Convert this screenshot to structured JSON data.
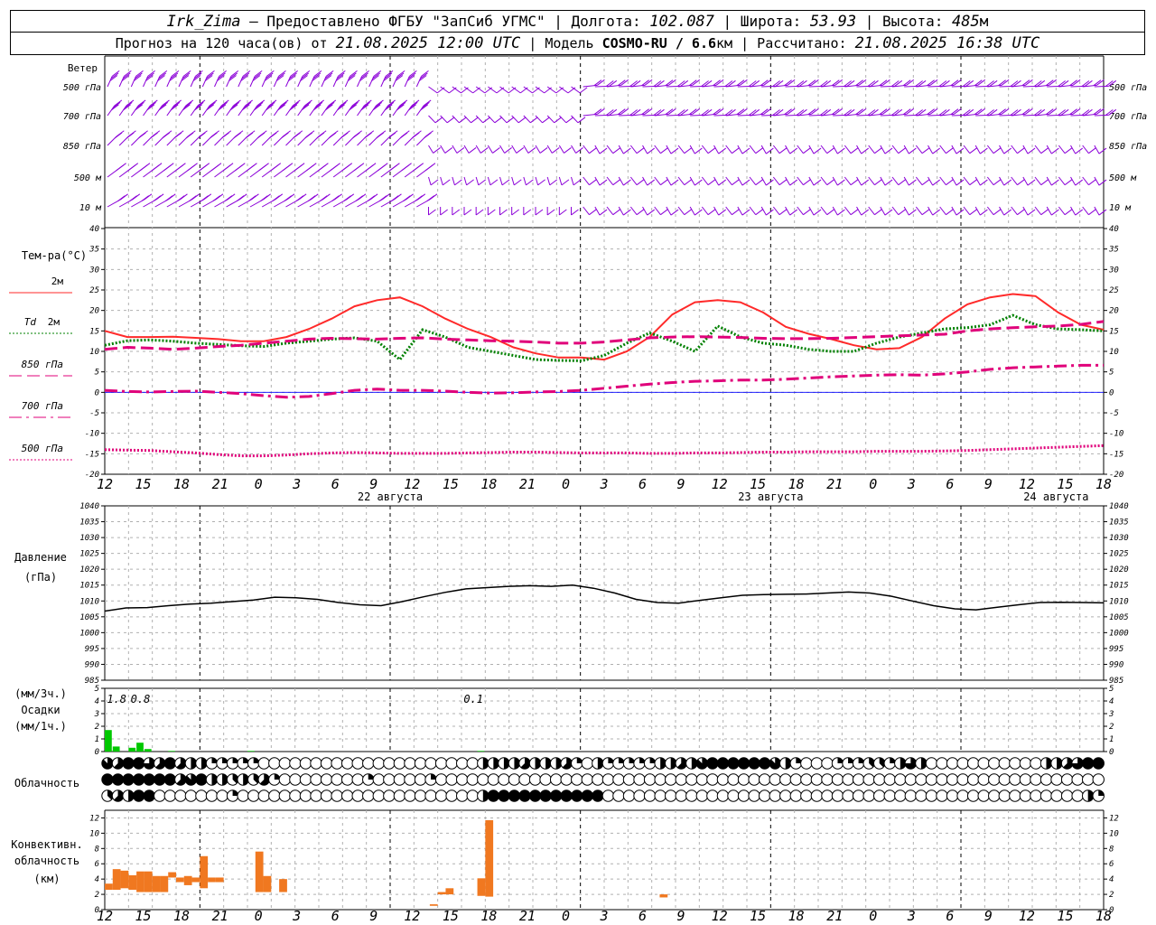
{
  "header": {
    "station": "Irk_Zima",
    "provider": " – Предоставлено ФГБУ \"ЗапСиб УГМС\" | Долгота: ",
    "lon": "102.087",
    "lat_label": " | Широта: ",
    "lat": "53.93",
    "alt_label": " | Высота: ",
    "alt": "485",
    "alt_unit": "м",
    "fc_label": "Прогноз на 120 часа(ов) от ",
    "fc_start": "21.08.2025 12:00 UTC",
    "model_label": " | Модель ",
    "model": "COSMO-RU / 6.6",
    "model_unit": "км",
    "calc_label": " | Рассчитано: ",
    "calc_time": "21.08.2025 16:38 UTC"
  },
  "colors": {
    "wind": "#8b00d8",
    "t2m": "#ff2a2a",
    "td2m": "#008000",
    "t850": "#e0007a",
    "t700": "#e0007a",
    "t500": "#e0007a",
    "pressure": "#000000",
    "precip": "#00c800",
    "conv": "#f07820",
    "zero_line": "#0000ff",
    "grid": "#b0b0b0"
  },
  "time_axis": {
    "hour_labels": [
      "12",
      "15",
      "18",
      "21",
      "0",
      "3",
      "6",
      "9",
      "12",
      "15",
      "18",
      "21",
      "0",
      "3",
      "6",
      "9",
      "12",
      "15",
      "18",
      "21",
      "0",
      "3",
      "6",
      "9",
      "12",
      "15",
      "18"
    ],
    "date_labels": [
      "22 августа",
      "23 августа",
      "24 августа"
    ]
  },
  "wind_panel": {
    "title": "Ветер",
    "levels": [
      "500 гПа",
      "700 гПа",
      "850 гПа",
      "500 м",
      "10  м"
    ]
  },
  "chart_data": [
    {
      "type": "line",
      "panel": "temperature",
      "title": "Тем-ра(°C)",
      "x_hours_from_start": [
        0,
        3,
        6,
        9,
        12,
        15,
        18,
        21,
        24,
        27,
        30,
        33,
        36,
        39,
        42,
        45,
        48,
        51,
        54,
        57,
        60,
        63,
        66,
        69,
        72,
        75,
        78,
        81,
        84,
        87,
        90,
        93,
        96,
        99,
        102,
        105,
        108,
        111,
        114,
        117,
        120,
        123,
        126
      ],
      "ylim": [
        -20,
        40
      ],
      "yticks": [
        -20,
        -15,
        -10,
        -5,
        0,
        5,
        10,
        15,
        20,
        25,
        30,
        35,
        40
      ],
      "series": [
        {
          "name": "2м",
          "key": "t2m",
          "style": "solid",
          "values": [
            15,
            13.5,
            13.5,
            13.6,
            13.3,
            13,
            12.5,
            12.5,
            13.5,
            15.5,
            18,
            21,
            22.5,
            23.2,
            21,
            18,
            15.5,
            13.5,
            11,
            9.5,
            8.5,
            8.5,
            8,
            10,
            13.5,
            19,
            22,
            22.5,
            22,
            19.5,
            16,
            14.3,
            13,
            11.5,
            10.5,
            10.8,
            13.5,
            18,
            21.5,
            23.2,
            24,
            23.5,
            19.5,
            16.5,
            15.3
          ]
        },
        {
          "name": "Td 2м",
          "key": "td2m",
          "style": "dotted",
          "values": [
            11.5,
            12.6,
            12.8,
            12.5,
            12,
            11.7,
            11.4,
            11.2,
            12,
            12.5,
            13,
            13.3,
            12.5,
            8,
            15.3,
            13.5,
            11,
            10,
            9,
            8,
            7.8,
            7.7,
            9,
            12,
            14.5,
            12.5,
            10,
            16.2,
            13.5,
            12,
            11.5,
            10.5,
            10,
            10,
            12,
            13.5,
            14.5,
            15.5,
            15.8,
            16.5,
            18.8,
            16.5,
            15.5,
            15.3,
            15
          ]
        },
        {
          "name": "850 гПа",
          "key": "t850",
          "style": "longdash",
          "values": [
            10.5,
            11,
            10.8,
            10.5,
            10.8,
            11.2,
            11.5,
            12,
            12.5,
            13,
            13.2,
            13.1,
            13,
            13.2,
            13.3,
            13,
            12.8,
            12.6,
            12.5,
            12.3,
            12,
            12,
            12.3,
            12.8,
            13.3,
            13.5,
            13.6,
            13.5,
            13.4,
            13.2,
            13.1,
            13.1,
            13.2,
            13.4,
            13.6,
            13.8,
            14,
            14.2,
            15,
            15.5,
            15.8,
            16,
            16.2,
            16.6,
            17.3
          ]
        },
        {
          "name": "700 гПа",
          "key": "t700",
          "style": "dashdot",
          "values": [
            0.5,
            0.2,
            0.1,
            0.2,
            0.3,
            0,
            -0.3,
            -0.8,
            -1.2,
            -1,
            -0.3,
            0.5,
            0.8,
            0.5,
            0.5,
            0.3,
            0,
            -0.2,
            -0.1,
            0.1,
            0.2,
            0.5,
            1,
            1.5,
            2,
            2.4,
            2.7,
            2.8,
            3,
            3,
            3.2,
            3.5,
            3.8,
            4,
            4.2,
            4.3,
            4.2,
            4.5,
            5,
            5.6,
            6,
            6.2,
            6.4,
            6.6,
            6.6
          ]
        },
        {
          "name": "500 гПа",
          "key": "t500",
          "style": "dotted",
          "values": [
            -14,
            -14.1,
            -14.2,
            -14.5,
            -14.8,
            -15.2,
            -15.5,
            -15.5,
            -15.3,
            -15,
            -14.8,
            -14.7,
            -14.8,
            -14.9,
            -14.9,
            -14.9,
            -14.8,
            -14.7,
            -14.6,
            -14.6,
            -14.7,
            -14.8,
            -14.8,
            -14.8,
            -14.9,
            -14.9,
            -14.8,
            -14.8,
            -14.7,
            -14.6,
            -14.6,
            -14.5,
            -14.5,
            -14.5,
            -14.4,
            -14.4,
            -14.4,
            -14.3,
            -14.2,
            -14,
            -13.8,
            -13.6,
            -13.4,
            -13.2,
            -13
          ]
        }
      ]
    },
    {
      "type": "line",
      "panel": "pressure",
      "title": "Давление",
      "unit": "(гПа)",
      "ylim": [
        985,
        1040
      ],
      "yticks": [
        985,
        990,
        995,
        1000,
        1005,
        1010,
        1015,
        1020,
        1025,
        1030,
        1035,
        1040
      ],
      "x_hours_from_start": [
        0,
        3,
        6,
        9,
        12,
        15,
        18,
        21,
        24,
        27,
        30,
        33,
        36,
        39,
        42,
        45,
        48,
        51,
        54,
        57,
        60,
        63,
        66,
        69,
        72,
        75,
        78,
        81,
        84,
        87,
        90,
        93,
        96,
        99,
        102,
        105,
        108,
        111,
        114,
        117,
        120,
        123,
        126
      ],
      "series": [
        {
          "name": "Давление",
          "values": [
            1006.8,
            1007.8,
            1007.9,
            1008.5,
            1009,
            1009.3,
            1009.8,
            1010.3,
            1011.2,
            1011,
            1010.5,
            1009.5,
            1008.8,
            1008.5,
            1009.8,
            1011.3,
            1012.7,
            1013.8,
            1014.2,
            1014.6,
            1014.8,
            1014.6,
            1015,
            1014,
            1012.5,
            1010.5,
            1009.5,
            1009.3,
            1010.2,
            1011,
            1011.8,
            1012,
            1012.1,
            1012.2,
            1012.5,
            1012.8,
            1012.5,
            1011.5,
            1010,
            1008.5,
            1007.5,
            1007.2,
            1008,
            1008.8,
            1009.5,
            1009.6,
            1009.5,
            1009.4
          ]
        }
      ]
    },
    {
      "type": "bar",
      "panel": "precipitation",
      "title": "Осадки",
      "units": [
        "(мм/3ч.)",
        "(мм/1ч.)"
      ],
      "ylim": [
        0,
        5
      ],
      "yticks": [
        0,
        1,
        2,
        3,
        4,
        5
      ],
      "totals_3h": [
        {
          "hour": 1.5,
          "label": "1.8"
        },
        {
          "hour": 4.5,
          "label": "0.8"
        },
        {
          "hour": 46.5,
          "label": "0.1"
        }
      ],
      "bars_1h": [
        {
          "hour": 0.5,
          "value": 1.7
        },
        {
          "hour": 1.5,
          "value": 0.4
        },
        {
          "hour": 3.5,
          "value": 0.3
        },
        {
          "hour": 4.5,
          "value": 0.7
        },
        {
          "hour": 5.5,
          "value": 0.2
        },
        {
          "hour": 8.5,
          "value": 0.05
        },
        {
          "hour": 18.5,
          "value": 0.05
        },
        {
          "hour": 47.5,
          "value": 0.05
        }
      ]
    },
    {
      "type": "table",
      "panel": "cloudiness",
      "title": "Облачность",
      "note": "cloud cover in octas per hour, rows: upper, middle, lower",
      "rows": [
        [
          7,
          5,
          8,
          8,
          6,
          5,
          8,
          5,
          4,
          4,
          2,
          2,
          2,
          2,
          2,
          0,
          0,
          0,
          0,
          0,
          0,
          0,
          0,
          0,
          0,
          0,
          0,
          0,
          0,
          0,
          0,
          0,
          0,
          0,
          0,
          0,
          4,
          4,
          4,
          4,
          5,
          4,
          4,
          4,
          5,
          2,
          0,
          4,
          2,
          2,
          2,
          2,
          2,
          4,
          4,
          5,
          4,
          7,
          8,
          8,
          8,
          8,
          8,
          8,
          7,
          4,
          2,
          0,
          0,
          0,
          2,
          2,
          2,
          3,
          3,
          2,
          4,
          6,
          4,
          0,
          0,
          0,
          0,
          0,
          0,
          0,
          0,
          0,
          0,
          0,
          4,
          4,
          5,
          6,
          8,
          8
        ],
        [
          8,
          8,
          8,
          8,
          8,
          8,
          8,
          5,
          7,
          8,
          4,
          4,
          3,
          4,
          3,
          5,
          2,
          0,
          0,
          0,
          0,
          0,
          0,
          0,
          0,
          2,
          0,
          0,
          0,
          0,
          0,
          2,
          0,
          0,
          0,
          0,
          0,
          0,
          0,
          0,
          0,
          0,
          0,
          0,
          0,
          0,
          0,
          0,
          0,
          0,
          0,
          0,
          0,
          0,
          0,
          0,
          0,
          0,
          0,
          0,
          0,
          0,
          0,
          0,
          0,
          0,
          0,
          0,
          0,
          0,
          0,
          0,
          0,
          0,
          0,
          0,
          0,
          0,
          0,
          0,
          0,
          0,
          0,
          0,
          0,
          0,
          0,
          0,
          0,
          0,
          0,
          0,
          0,
          0,
          0,
          0
        ],
        [
          3,
          5,
          4,
          8,
          8,
          0,
          0,
          0,
          0,
          0,
          0,
          0,
          2,
          0,
          0,
          0,
          0,
          0,
          0,
          0,
          0,
          0,
          0,
          0,
          0,
          0,
          0,
          0,
          0,
          0,
          0,
          0,
          0,
          0,
          0,
          0,
          4,
          8,
          8,
          8,
          8,
          8,
          8,
          8,
          8,
          8,
          8,
          8,
          0,
          0,
          0,
          0,
          0,
          0,
          0,
          0,
          0,
          0,
          0,
          0,
          0,
          0,
          0,
          0,
          0,
          0,
          0,
          0,
          0,
          0,
          0,
          0,
          0,
          0,
          0,
          0,
          0,
          0,
          0,
          0,
          0,
          0,
          0,
          0,
          0,
          0,
          0,
          0,
          0,
          0,
          0,
          0,
          0,
          0,
          4,
          2
        ]
      ]
    },
    {
      "type": "bar",
      "panel": "convective",
      "title": "Конвективн.",
      "title2": "облачность",
      "unit": "(км)",
      "ylim": [
        0,
        13
      ],
      "yticks": [
        0,
        2,
        4,
        6,
        8,
        10,
        12
      ],
      "segments": [
        {
          "hour": 0,
          "base": 2.6,
          "top": 3.4
        },
        {
          "hour": 1,
          "base": 2.6,
          "top": 5.3
        },
        {
          "hour": 2,
          "base": 2.8,
          "top": 5.1
        },
        {
          "hour": 3,
          "base": 2.6,
          "top": 4.5
        },
        {
          "hour": 4,
          "base": 2.3,
          "top": 5.0
        },
        {
          "hour": 5,
          "base": 2.3,
          "top": 5.0
        },
        {
          "hour": 6,
          "base": 2.3,
          "top": 4.4
        },
        {
          "hour": 7,
          "base": 2.3,
          "top": 4.4
        },
        {
          "hour": 8,
          "base": 4.2,
          "top": 4.9
        },
        {
          "hour": 9,
          "base": 3.6,
          "top": 4.2
        },
        {
          "hour": 10,
          "base": 3.2,
          "top": 4.4
        },
        {
          "hour": 11,
          "base": 3.6,
          "top": 4.2
        },
        {
          "hour": 12,
          "base": 2.8,
          "top": 7.0
        },
        {
          "hour": 13,
          "base": 3.6,
          "top": 4.2
        },
        {
          "hour": 14,
          "base": 3.6,
          "top": 4.2
        },
        {
          "hour": 19,
          "base": 2.3,
          "top": 7.6
        },
        {
          "hour": 20,
          "base": 2.3,
          "top": 4.4
        },
        {
          "hour": 22,
          "base": 2.3,
          "top": 4.0
        },
        {
          "hour": 41,
          "base": 0.5,
          "top": 0.7
        },
        {
          "hour": 42,
          "base": 2.0,
          "top": 2.3
        },
        {
          "hour": 43,
          "base": 2.0,
          "top": 2.8
        },
        {
          "hour": 47,
          "base": 1.8,
          "top": 4.1
        },
        {
          "hour": 48,
          "base": 1.7,
          "top": 11.7
        },
        {
          "hour": 70,
          "base": 1.6,
          "top": 2.0
        }
      ]
    }
  ]
}
